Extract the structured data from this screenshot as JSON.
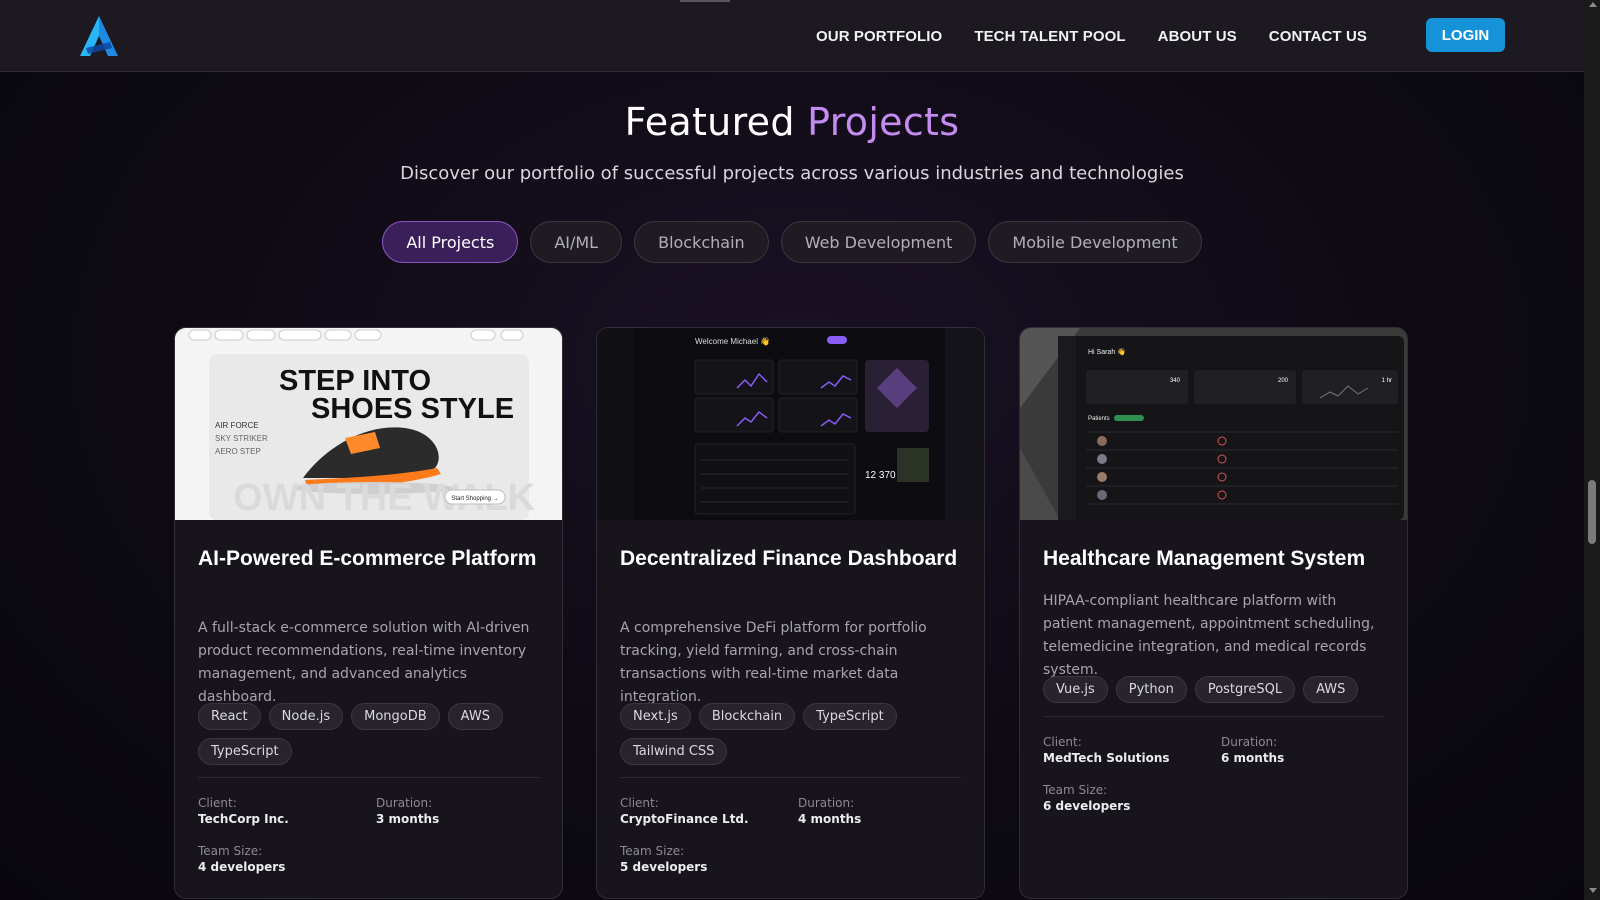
{
  "nav": {
    "items": [
      "OUR PORTFOLIO",
      "TECH TALENT POOL",
      "ABOUT US",
      "CONTACT US"
    ],
    "login_label": "LOGIN"
  },
  "hero": {
    "title_main": "Featured ",
    "title_accent": "Projects",
    "subtitle": "Discover our portfolio of successful projects across various industries and technologies"
  },
  "filters": [
    "All Projects",
    "AI/ML",
    "Blockchain",
    "Web Development",
    "Mobile Development"
  ],
  "labels": {
    "client": "Client:",
    "duration": "Duration:",
    "team": "Team Size:"
  },
  "projects": [
    {
      "title": "AI-Powered E-commerce Platform",
      "description": "A full-stack e-commerce solution with AI-driven product recommendations, real-time inventory management, and advanced analytics dashboard.",
      "tags": [
        "React",
        "Node.js",
        "MongoDB",
        "AWS",
        "TypeScript"
      ],
      "client": "TechCorp Inc.",
      "duration": "3 months",
      "team_size": "4 developers",
      "thumb": {
        "headline_1": "STEP INTO",
        "headline_2": "SHOES STYLE",
        "side_1": "AIR FORCE",
        "side_2": "SKY STRIKER",
        "side_3": "AERO STEP",
        "watermark": "OWN THE WALK",
        "cta": "Start Shopping →"
      }
    },
    {
      "title": "Decentralized Finance Dashboard",
      "description": "A comprehensive DeFi platform for portfolio tracking, yield farming, and cross-chain transactions with real-time market data integration.",
      "tags": [
        "Next.js",
        "Blockchain",
        "TypeScript",
        "Tailwind CSS"
      ],
      "client": "CryptoFinance Ltd.",
      "duration": "4 months",
      "team_size": "5 developers",
      "thumb": {
        "greeting": "Welcome Michael 👋",
        "stat": "12 370"
      }
    },
    {
      "title": "Healthcare Management System",
      "description": "HIPAA-compliant healthcare platform with patient management, appointment scheduling, telemedicine integration, and medical records system.",
      "tags": [
        "Vue.js",
        "Python",
        "PostgreSQL",
        "AWS"
      ],
      "client": "MedTech Solutions",
      "duration": "6 months",
      "team_size": "6 developers",
      "thumb": {
        "greeting": "Hi Sarah 👋",
        "stat_1": "340",
        "stat_2": "200",
        "stat_3": "1 hr",
        "table_title": "Patients"
      }
    }
  ],
  "colors": {
    "accent_purple": "#c48cf0",
    "login_blue": "#1592d8",
    "active_filter_bg": "#3b1f5a"
  }
}
